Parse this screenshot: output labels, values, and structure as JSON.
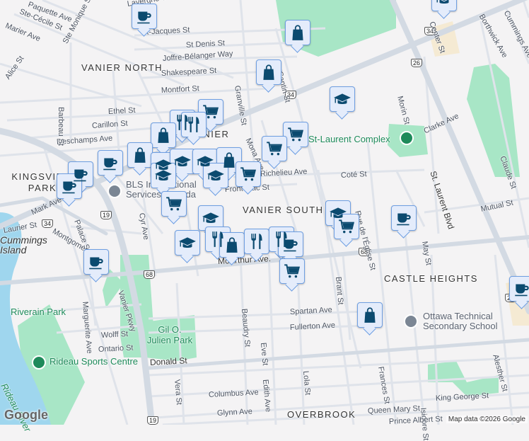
{
  "map": {
    "areas": [
      "VANIER NORTH",
      "VANIER",
      "VANIER SOUTH",
      "KINGSVIEW PARK",
      "CASTLE HEIGHTS",
      "OVERBROOK",
      "Cummings Island"
    ],
    "parks": [
      "Riverain Park",
      "Gil O. Julien Park",
      "Rideau River"
    ],
    "pois": [
      "St-Laurent Complex",
      "BLS International Services Canada",
      "Ottawa Technical Secondary School",
      "Rideau Sports Centre"
    ],
    "streets": [
      "Ste-Cécile St",
      "Marier Ave",
      "Ste Monique St",
      "St-Jacques St",
      "St Denis St",
      "Joffre-Bélanger Way",
      "Shakespeare St",
      "Montfort St",
      "Ethel St",
      "Carillon St",
      "Deschamps Ave",
      "Barbeau St",
      "Alice St",
      "Granville St",
      "Mona Ave",
      "Cantin St",
      "Morin St",
      "St. Laurent Blvd",
      "Clarke Ave",
      "Coté St",
      "Richelieu Ave",
      "Frontenac St",
      "Rue de l'Église St",
      "Mutual St",
      "May St",
      "McArthur Ave.",
      "Brant St",
      "Spartan Ave",
      "Fullerton Ave",
      "Donald St",
      "Frances St",
      "Alesther St",
      "Columbus Ave",
      "Glynn Ave",
      "King George St",
      "Queen Mary St",
      "Lola St",
      "Edith Ave",
      "Eve St",
      "Beaudry St",
      "Vera St",
      "Vanier Pkwy",
      "Marguerite Ave",
      "Wolff St",
      "Ontario St",
      "Palace St",
      "Mark Ave",
      "Center St",
      "Borthwick Ave",
      "Cummings Ave",
      "Claude St",
      "Lavergne St",
      "Montgomery St",
      "Cyr Ave",
      "Paquette Ave",
      "Laurier St",
      "Isidore St",
      "Prince Albert St"
    ],
    "route_shields": [
      "34",
      "34",
      "34",
      "26",
      "19",
      "19",
      "68",
      "68",
      "24"
    ],
    "markers": [
      "coffee",
      "bag",
      "bag",
      "graduation-cap",
      "cart",
      "restaurant",
      "restaurant",
      "bag",
      "cart",
      "cart",
      "coffee",
      "bag",
      "graduation-cap",
      "graduation-cap",
      "graduation-cap",
      "bag",
      "cart",
      "graduation-cap",
      "graduation-cap",
      "coffee",
      "coffee",
      "cart",
      "graduation-cap",
      "graduation-cap",
      "cart",
      "coffee",
      "graduation-cap",
      "restaurant",
      "bag",
      "restaurant",
      "restaurant",
      "coffee",
      "coffee",
      "cart",
      "bag",
      "coffee",
      "graduation-cap"
    ],
    "attribution": "Map data ©2026 Google",
    "logo": "Google"
  },
  "colors": {
    "marker_fill": "#e4ecfb",
    "marker_border": "#6f9fe2",
    "icon": "#0b4a6f",
    "water": "#9fd6ee",
    "park": "#a8e6c6",
    "road": "#d3dae3"
  }
}
